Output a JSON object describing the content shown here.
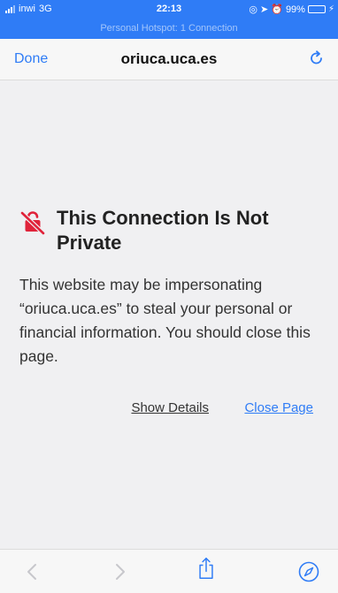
{
  "status_bar": {
    "carrier": "inwi",
    "network": "3G",
    "time": "22:13",
    "battery": "99%",
    "hotspot": "Personal Hotspot: 1 Connection"
  },
  "nav": {
    "done_label": "Done",
    "title": "oriuca.uca.es"
  },
  "warning": {
    "heading": "This Connection Is Not Private",
    "message": "This website may be impersonating “oriuca.uca.es” to steal your personal or financial information. You should close this page.",
    "show_details_label": "Show Details",
    "close_page_label": "Close Page"
  },
  "icons": {
    "reload": "reload-icon",
    "warning": "unlocked-lock-icon",
    "back": "back-arrow-icon",
    "forward": "forward-arrow-icon",
    "share": "share-icon",
    "safari": "compass-icon"
  },
  "colors": {
    "accent": "#2f7cf6",
    "warning_red": "#e0233a",
    "background": "#f0f0f2"
  }
}
